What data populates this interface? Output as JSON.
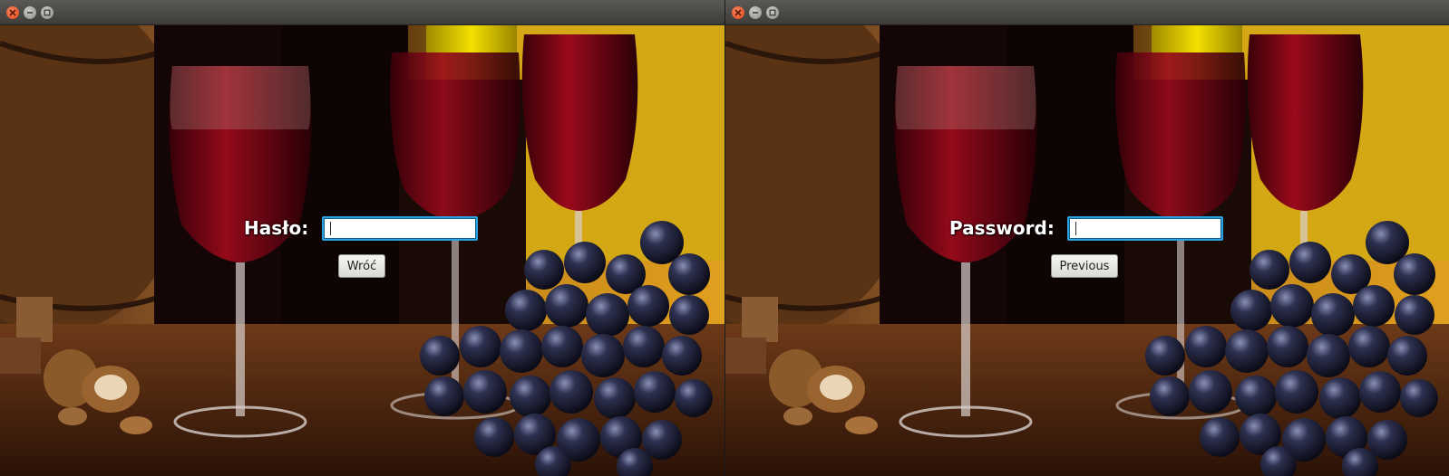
{
  "windows": [
    {
      "password_label": "Hasło:",
      "password_value": "",
      "back_label": "Wróć"
    },
    {
      "password_label": "Password:",
      "password_value": "",
      "back_label": "Previous"
    }
  ],
  "colors": {
    "input_focus_border": "#2aa3e0",
    "titlebar": "#4a4945",
    "close_button": "#e0481b"
  },
  "icons": [
    "close-icon",
    "minimize-icon",
    "maximize-icon"
  ]
}
